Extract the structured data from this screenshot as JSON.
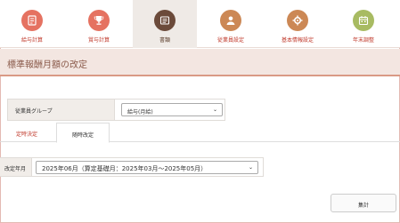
{
  "nav": {
    "items": [
      {
        "label": "給与計算",
        "icon": "payroll-icon",
        "color": "#e57261"
      },
      {
        "label": "賞与計算",
        "icon": "trophy-icon",
        "color": "#e57261"
      },
      {
        "label": "書類",
        "icon": "document-icon",
        "color": "#6b4a3a"
      },
      {
        "label": "従業員設定",
        "icon": "person-icon",
        "color": "#cc8855"
      },
      {
        "label": "基本情報設定",
        "icon": "gear-icon",
        "color": "#cc8855"
      },
      {
        "label": "年末調整",
        "icon": "calendar-icon",
        "color": "#a8bb62"
      }
    ],
    "active_index": 2
  },
  "page": {
    "title": "標準報酬月額の改定"
  },
  "group": {
    "label": "従業員グループ",
    "selected": "給与(月給)"
  },
  "tabs": {
    "items": [
      "定時決定",
      "随時改定"
    ],
    "active_index": 1
  },
  "revision": {
    "label": "改定年月",
    "selected": "2025年06月（算定基礎月：2025年03月～2025年05月）"
  },
  "actions": {
    "calculate_label": "集計"
  },
  "colors": {
    "accent": "#c0392b",
    "title_bg": "#f3e6e1",
    "title_border": "#d99a85"
  }
}
